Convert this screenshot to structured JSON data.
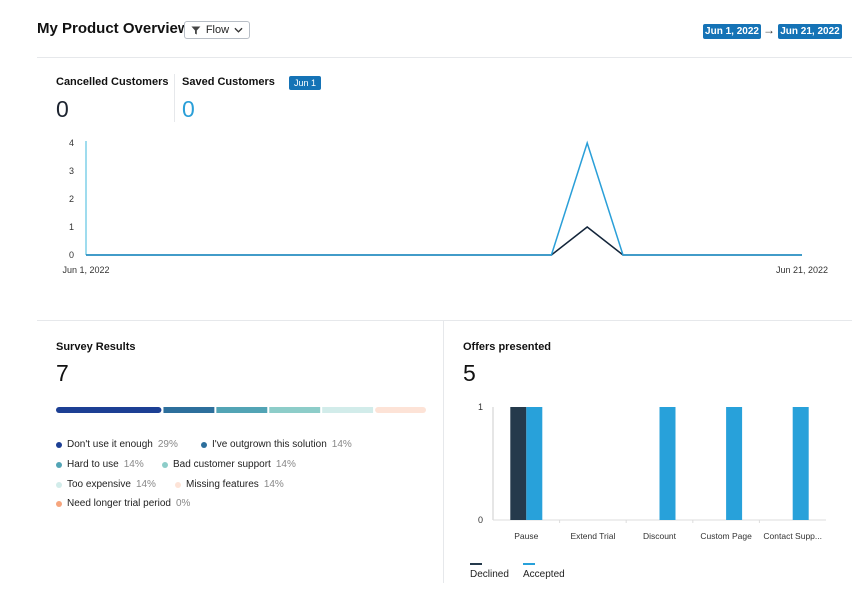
{
  "header": {
    "title": "My Product Overview",
    "filter_label": "Flow",
    "date_start": "Jun 1, 2022",
    "date_end": "Jun 21, 2022"
  },
  "stats": {
    "cancelled_label": "Cancelled Customers",
    "cancelled_value": "0",
    "saved_label": "Saved Customers",
    "saved_value": "0",
    "hover_badge": "Jun 1"
  },
  "colors": {
    "accent": "#1573b6",
    "saved_line": "#2a9fd8",
    "cancelled_line": "#13253a",
    "declined_bar": "#253a4c",
    "accepted_bar": "#28a1da"
  },
  "chart_data": [
    {
      "type": "line",
      "y_ticks": [
        "0",
        "1",
        "2",
        "3",
        "4"
      ],
      "ylim": [
        0,
        4
      ],
      "x_tick_labels": [
        "Jun 1, 2022",
        "Jun 21, 2022"
      ],
      "x": [
        "Jun 1",
        "Jun 2",
        "Jun 3",
        "Jun 4",
        "Jun 5",
        "Jun 6",
        "Jun 7",
        "Jun 8",
        "Jun 9",
        "Jun 10",
        "Jun 11",
        "Jun 12",
        "Jun 13",
        "Jun 14",
        "Jun 15",
        "Jun 16",
        "Jun 17",
        "Jun 18",
        "Jun 19",
        "Jun 20",
        "Jun 21"
      ],
      "series": [
        {
          "values": [
            0,
            0,
            0,
            0,
            0,
            0,
            0,
            0,
            0,
            0,
            0,
            0,
            0,
            0,
            1,
            0,
            0,
            0,
            0,
            0,
            0
          ],
          "color": "#13253a"
        },
        {
          "values": [
            0,
            0,
            0,
            0,
            0,
            0,
            0,
            0,
            0,
            0,
            0,
            0,
            0,
            0,
            4,
            0,
            0,
            0,
            0,
            0,
            0
          ],
          "color": "#2a9fd8"
        }
      ]
    },
    {
      "type": "bar",
      "title": "Offers presented",
      "categories": [
        "Pause",
        "Extend Trial",
        "Discount",
        "Custom Page",
        "Contact Supp..."
      ],
      "y_ticks": [
        "0",
        "1"
      ],
      "ylim": [
        0,
        1
      ],
      "series": [
        {
          "name": "Declined",
          "values": [
            1,
            0,
            0,
            0,
            0
          ],
          "color": "#253a4c"
        },
        {
          "name": "Accepted",
          "values": [
            1,
            0,
            1,
            1,
            1
          ],
          "color": "#28a1da"
        }
      ]
    }
  ],
  "survey": {
    "title": "Survey Results",
    "total": "7",
    "items": [
      {
        "label": "Don't use it enough",
        "pct": "29%",
        "value": 29,
        "color": "#1c3f94"
      },
      {
        "label": "I've outgrown this solution",
        "pct": "14%",
        "value": 14,
        "color": "#2d6f9c"
      },
      {
        "label": "Hard to use",
        "pct": "14%",
        "value": 14,
        "color": "#52a4b5"
      },
      {
        "label": "Bad customer support",
        "pct": "14%",
        "value": 14,
        "color": "#8dcdc9"
      },
      {
        "label": "Too expensive",
        "pct": "14%",
        "value": 14,
        "color": "#d2ecea"
      },
      {
        "label": "Missing features",
        "pct": "14%",
        "value": 14,
        "color": "#fde3d7"
      },
      {
        "label": "Need longer trial period",
        "pct": "0%",
        "value": 0,
        "color": "#f6a57d"
      }
    ]
  },
  "offers": {
    "title": "Offers presented",
    "total": "5"
  }
}
